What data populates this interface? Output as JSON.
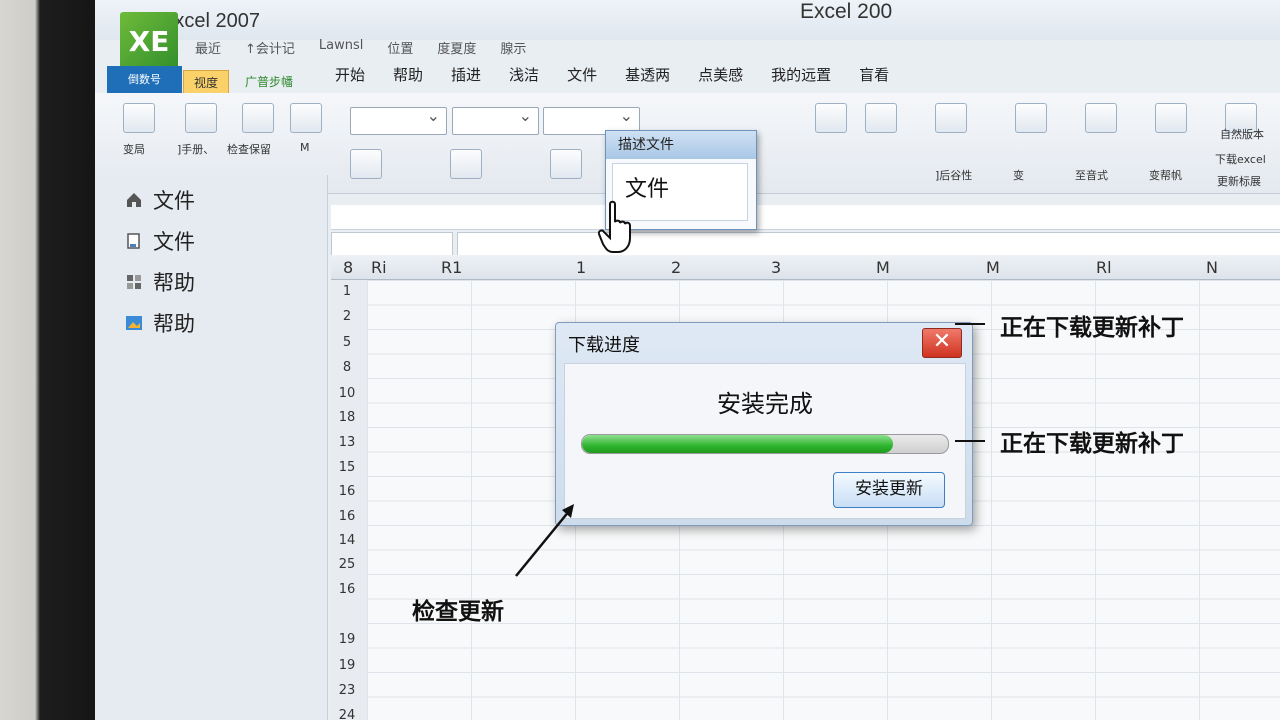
{
  "app": {
    "title": "Excel 2007",
    "window_title": "Excel 200",
    "logo_text": "XE",
    "app_menu_label": "倒数号"
  },
  "quick_access": [
    "最近",
    "↑会计记",
    "Lawnsl",
    "位置",
    "度夏度",
    "腺示"
  ],
  "left_tabs": [
    "视度",
    "广普步幡"
  ],
  "menu": [
    "开始",
    "帮助",
    "插进",
    "浅洁",
    "文件",
    "基透两",
    "点美感",
    "我的远置",
    "盲看"
  ],
  "ribbon": {
    "left_labels": [
      "变局",
      "]手册、",
      "检查保留",
      "M"
    ],
    "group_labels": [
      "]后谷性",
      "变",
      "至音式",
      "变帮帆",
      "自然版本",
      "下载excel",
      "更新标展"
    ]
  },
  "sidebar": {
    "items": [
      {
        "label": "文件",
        "icon": "home-icon"
      },
      {
        "label": "文件",
        "icon": "document-icon"
      },
      {
        "label": "帮助",
        "icon": "grid-help-icon"
      },
      {
        "label": "帮助",
        "icon": "image-help-icon"
      }
    ]
  },
  "grid": {
    "columns": [
      "8",
      "Ri",
      "R1",
      "1",
      "2",
      "3",
      "M",
      "M",
      "Rl",
      "N"
    ],
    "rows": [
      "1",
      "2",
      "5",
      "8",
      "10",
      "18",
      "13",
      "15",
      "16",
      "16",
      "14",
      "25",
      "16",
      "19",
      "19",
      "23",
      "24"
    ]
  },
  "popup": {
    "title": "描述文件",
    "item": "文件"
  },
  "dialog": {
    "title": "下载进度",
    "close_label": "✕",
    "status": "安装完成",
    "progress": 0.85,
    "button": "安装更新"
  },
  "callouts": {
    "top_right_1": "正在下载更新补丁",
    "top_right_2": "正在下载更新补丁",
    "bottom_left": "检查更新"
  },
  "colors": {
    "accent": "#1f6fb8",
    "progress_green": "#2fb52f",
    "close_red": "#cf3220"
  }
}
